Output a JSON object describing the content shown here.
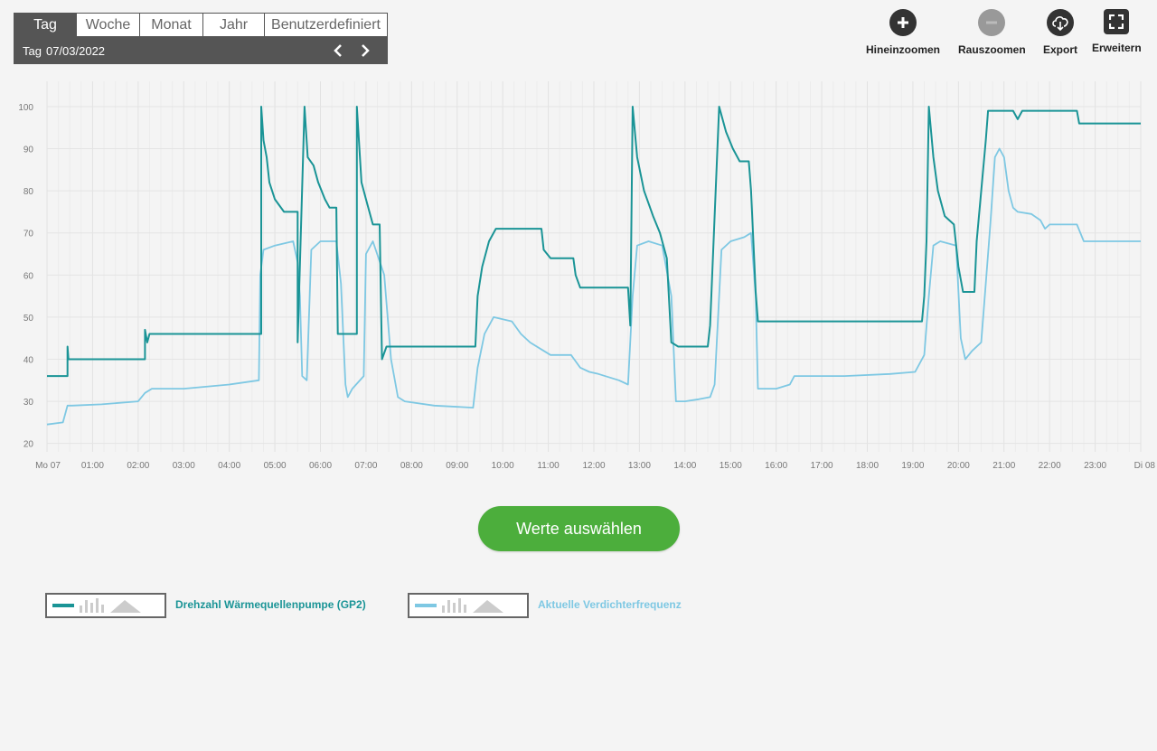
{
  "period": {
    "tabs": [
      {
        "label": "Tag",
        "active": true
      },
      {
        "label": "Woche",
        "active": false
      },
      {
        "label": "Monat",
        "active": false
      },
      {
        "label": "Jahr",
        "active": false
      },
      {
        "label": "Benutzerdefiniert",
        "active": false
      }
    ],
    "current_label": "Tag",
    "current_date": "07/03/2022",
    "prev_icon": "chevron-left-icon",
    "next_icon": "chevron-right-icon"
  },
  "toolbar": {
    "zoom_in": {
      "label": "Hineinzoomen",
      "icon": "plus-circle-icon"
    },
    "zoom_out": {
      "label": "Rauszoomen",
      "icon": "minus-circle-icon",
      "disabled": true
    },
    "export": {
      "label": "Export",
      "icon": "cloud-download-icon"
    },
    "expand": {
      "label": "Erweitern",
      "icon": "fullscreen-icon"
    }
  },
  "select_button": "Werte auswählen",
  "legend": [
    {
      "label": "Drehzahl Wärmequellenpumpe (GP2)",
      "color": "#1a9496"
    },
    {
      "label": "Aktuelle Verdichterfrequenz",
      "color": "#7ec8e3"
    }
  ],
  "chart_data": {
    "type": "line",
    "x_unit": "hours",
    "xlim": [
      0,
      24
    ],
    "ylim": [
      18,
      106
    ],
    "yticks": [
      20,
      30,
      40,
      50,
      60,
      70,
      80,
      90,
      100
    ],
    "xtick_labels": [
      "Mo 07",
      "01:00",
      "02:00",
      "03:00",
      "04:00",
      "05:00",
      "06:00",
      "07:00",
      "08:00",
      "09:00",
      "10:00",
      "11:00",
      "12:00",
      "13:00",
      "14:00",
      "15:00",
      "16:00",
      "17:00",
      "18:00",
      "19:00",
      "20:00",
      "21:00",
      "22:00",
      "23:00",
      "Di 08"
    ],
    "grid": true,
    "series": [
      {
        "name": "Drehzahl Wärmequellenpumpe (GP2)",
        "color": "#1a9496",
        "points": [
          [
            0,
            36
          ],
          [
            0.45,
            36
          ],
          [
            0.45,
            43
          ],
          [
            0.47,
            40
          ],
          [
            0.5,
            40
          ],
          [
            2.15,
            40
          ],
          [
            2.15,
            47
          ],
          [
            2.2,
            44
          ],
          [
            2.25,
            46
          ],
          [
            4.7,
            46
          ],
          [
            4.7,
            100
          ],
          [
            4.75,
            92
          ],
          [
            4.82,
            88
          ],
          [
            4.88,
            82
          ],
          [
            5.0,
            78
          ],
          [
            5.2,
            75
          ],
          [
            5.5,
            75
          ],
          [
            5.5,
            44
          ],
          [
            5.65,
            100
          ],
          [
            5.72,
            88
          ],
          [
            5.85,
            86
          ],
          [
            5.95,
            82
          ],
          [
            6.1,
            78
          ],
          [
            6.2,
            76
          ],
          [
            6.35,
            76
          ],
          [
            6.38,
            46
          ],
          [
            6.8,
            46
          ],
          [
            6.8,
            100
          ],
          [
            6.9,
            82
          ],
          [
            7.0,
            78
          ],
          [
            7.15,
            72
          ],
          [
            7.3,
            72
          ],
          [
            7.35,
            40
          ],
          [
            7.45,
            43
          ],
          [
            9.4,
            43
          ],
          [
            9.45,
            55
          ],
          [
            9.55,
            62
          ],
          [
            9.7,
            68
          ],
          [
            9.85,
            71
          ],
          [
            10.85,
            71
          ],
          [
            10.9,
            66
          ],
          [
            11.05,
            64
          ],
          [
            11.55,
            64
          ],
          [
            11.6,
            60
          ],
          [
            11.7,
            57
          ],
          [
            12.75,
            57
          ],
          [
            12.8,
            48
          ],
          [
            12.85,
            100
          ],
          [
            12.95,
            88
          ],
          [
            13.1,
            80
          ],
          [
            13.3,
            74
          ],
          [
            13.45,
            70
          ],
          [
            13.6,
            64
          ],
          [
            13.7,
            44
          ],
          [
            13.85,
            43
          ],
          [
            14.5,
            43
          ],
          [
            14.55,
            48
          ],
          [
            14.75,
            100
          ],
          [
            14.9,
            94
          ],
          [
            15.05,
            90
          ],
          [
            15.2,
            87
          ],
          [
            15.4,
            87
          ],
          [
            15.45,
            80
          ],
          [
            15.55,
            56
          ],
          [
            15.6,
            49
          ],
          [
            19.2,
            49
          ],
          [
            19.25,
            55
          ],
          [
            19.3,
            68
          ],
          [
            19.35,
            100
          ],
          [
            19.45,
            88
          ],
          [
            19.55,
            80
          ],
          [
            19.7,
            74
          ],
          [
            19.9,
            72
          ],
          [
            20.0,
            62
          ],
          [
            20.1,
            56
          ],
          [
            20.35,
            56
          ],
          [
            20.4,
            68
          ],
          [
            20.6,
            92
          ],
          [
            20.65,
            99
          ],
          [
            20.95,
            99
          ],
          [
            21.2,
            99
          ],
          [
            21.3,
            97
          ],
          [
            21.4,
            99
          ],
          [
            21.8,
            99
          ],
          [
            22.6,
            99
          ],
          [
            22.65,
            96
          ],
          [
            24,
            96
          ]
        ]
      },
      {
        "name": "Aktuelle Verdichterfrequenz",
        "color": "#7ec8e3",
        "points": [
          [
            0,
            24.5
          ],
          [
            0.35,
            25
          ],
          [
            0.45,
            29
          ],
          [
            0.55,
            29
          ],
          [
            1.2,
            29.3
          ],
          [
            2.0,
            30
          ],
          [
            2.15,
            32
          ],
          [
            2.3,
            33
          ],
          [
            3.0,
            33
          ],
          [
            4.0,
            34
          ],
          [
            4.65,
            35
          ],
          [
            4.68,
            60
          ],
          [
            4.75,
            66
          ],
          [
            5.0,
            67
          ],
          [
            5.4,
            68
          ],
          [
            5.5,
            63
          ],
          [
            5.55,
            55
          ],
          [
            5.6,
            36
          ],
          [
            5.7,
            35
          ],
          [
            5.8,
            66
          ],
          [
            6.0,
            68
          ],
          [
            6.35,
            68
          ],
          [
            6.45,
            58
          ],
          [
            6.55,
            34
          ],
          [
            6.6,
            31
          ],
          [
            6.7,
            33
          ],
          [
            6.95,
            36
          ],
          [
            7.0,
            65
          ],
          [
            7.15,
            68
          ],
          [
            7.4,
            60
          ],
          [
            7.55,
            40
          ],
          [
            7.7,
            31
          ],
          [
            7.85,
            30
          ],
          [
            8.5,
            29
          ],
          [
            9.35,
            28.5
          ],
          [
            9.45,
            38
          ],
          [
            9.6,
            46
          ],
          [
            9.8,
            50
          ],
          [
            10.2,
            49
          ],
          [
            10.4,
            46
          ],
          [
            10.6,
            44
          ],
          [
            10.9,
            42
          ],
          [
            11.05,
            41
          ],
          [
            11.5,
            41
          ],
          [
            11.7,
            38
          ],
          [
            11.9,
            37
          ],
          [
            12.1,
            36.5
          ],
          [
            12.55,
            35
          ],
          [
            12.75,
            34
          ],
          [
            12.85,
            55
          ],
          [
            12.95,
            67
          ],
          [
            13.2,
            68
          ],
          [
            13.5,
            67
          ],
          [
            13.7,
            55
          ],
          [
            13.8,
            30
          ],
          [
            14.0,
            30
          ],
          [
            14.3,
            30.5
          ],
          [
            14.55,
            31
          ],
          [
            14.65,
            34
          ],
          [
            14.8,
            66
          ],
          [
            15.0,
            68
          ],
          [
            15.3,
            69
          ],
          [
            15.45,
            70
          ],
          [
            15.55,
            55
          ],
          [
            15.6,
            33
          ],
          [
            16.0,
            33
          ],
          [
            16.3,
            34
          ],
          [
            16.4,
            36
          ],
          [
            16.6,
            36
          ],
          [
            17.5,
            36
          ],
          [
            18.5,
            36.5
          ],
          [
            19.05,
            37
          ],
          [
            19.25,
            41
          ],
          [
            19.35,
            55
          ],
          [
            19.45,
            67
          ],
          [
            19.6,
            68
          ],
          [
            19.95,
            67
          ],
          [
            20.05,
            45
          ],
          [
            20.15,
            40
          ],
          [
            20.3,
            42
          ],
          [
            20.5,
            44
          ],
          [
            20.6,
            58
          ],
          [
            20.7,
            72
          ],
          [
            20.8,
            88
          ],
          [
            20.9,
            90
          ],
          [
            21.0,
            88
          ],
          [
            21.1,
            80
          ],
          [
            21.2,
            76
          ],
          [
            21.3,
            75
          ],
          [
            21.6,
            74.5
          ],
          [
            21.8,
            73
          ],
          [
            21.9,
            71
          ],
          [
            22.0,
            72
          ],
          [
            22.6,
            72
          ],
          [
            22.75,
            68
          ],
          [
            24,
            68
          ]
        ]
      }
    ]
  }
}
